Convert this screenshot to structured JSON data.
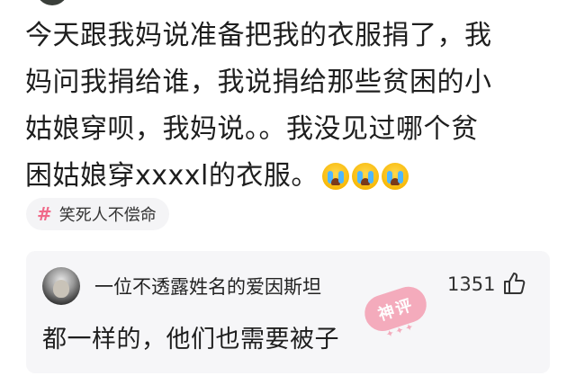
{
  "post": {
    "lines": [
      "今天跟我妈说准备把我的衣服捐了，我",
      "妈问我捐给谁，我说捐给那些贫困的小",
      "姑娘穿呗，我妈说。。我没见过哪个贫",
      "困姑娘穿xxxxl的衣服。"
    ],
    "emojis": [
      "loudly-crying-face",
      "loudly-crying-face",
      "loudly-crying-face"
    ]
  },
  "topic": {
    "icon": "hashtag-icon",
    "label": "笑死人不偿命"
  },
  "comment": {
    "username": "一位不透露姓名的爱因斯坦",
    "likes": "1351",
    "text": "都一样的，他们也需要被子",
    "stamp": "神评"
  },
  "colors": {
    "background": "#ffffff",
    "card": "#f6f6f8",
    "tag_bg": "#f4f4f6",
    "hashtag": "#f06a8a",
    "stamp": "#f4a7b9"
  }
}
